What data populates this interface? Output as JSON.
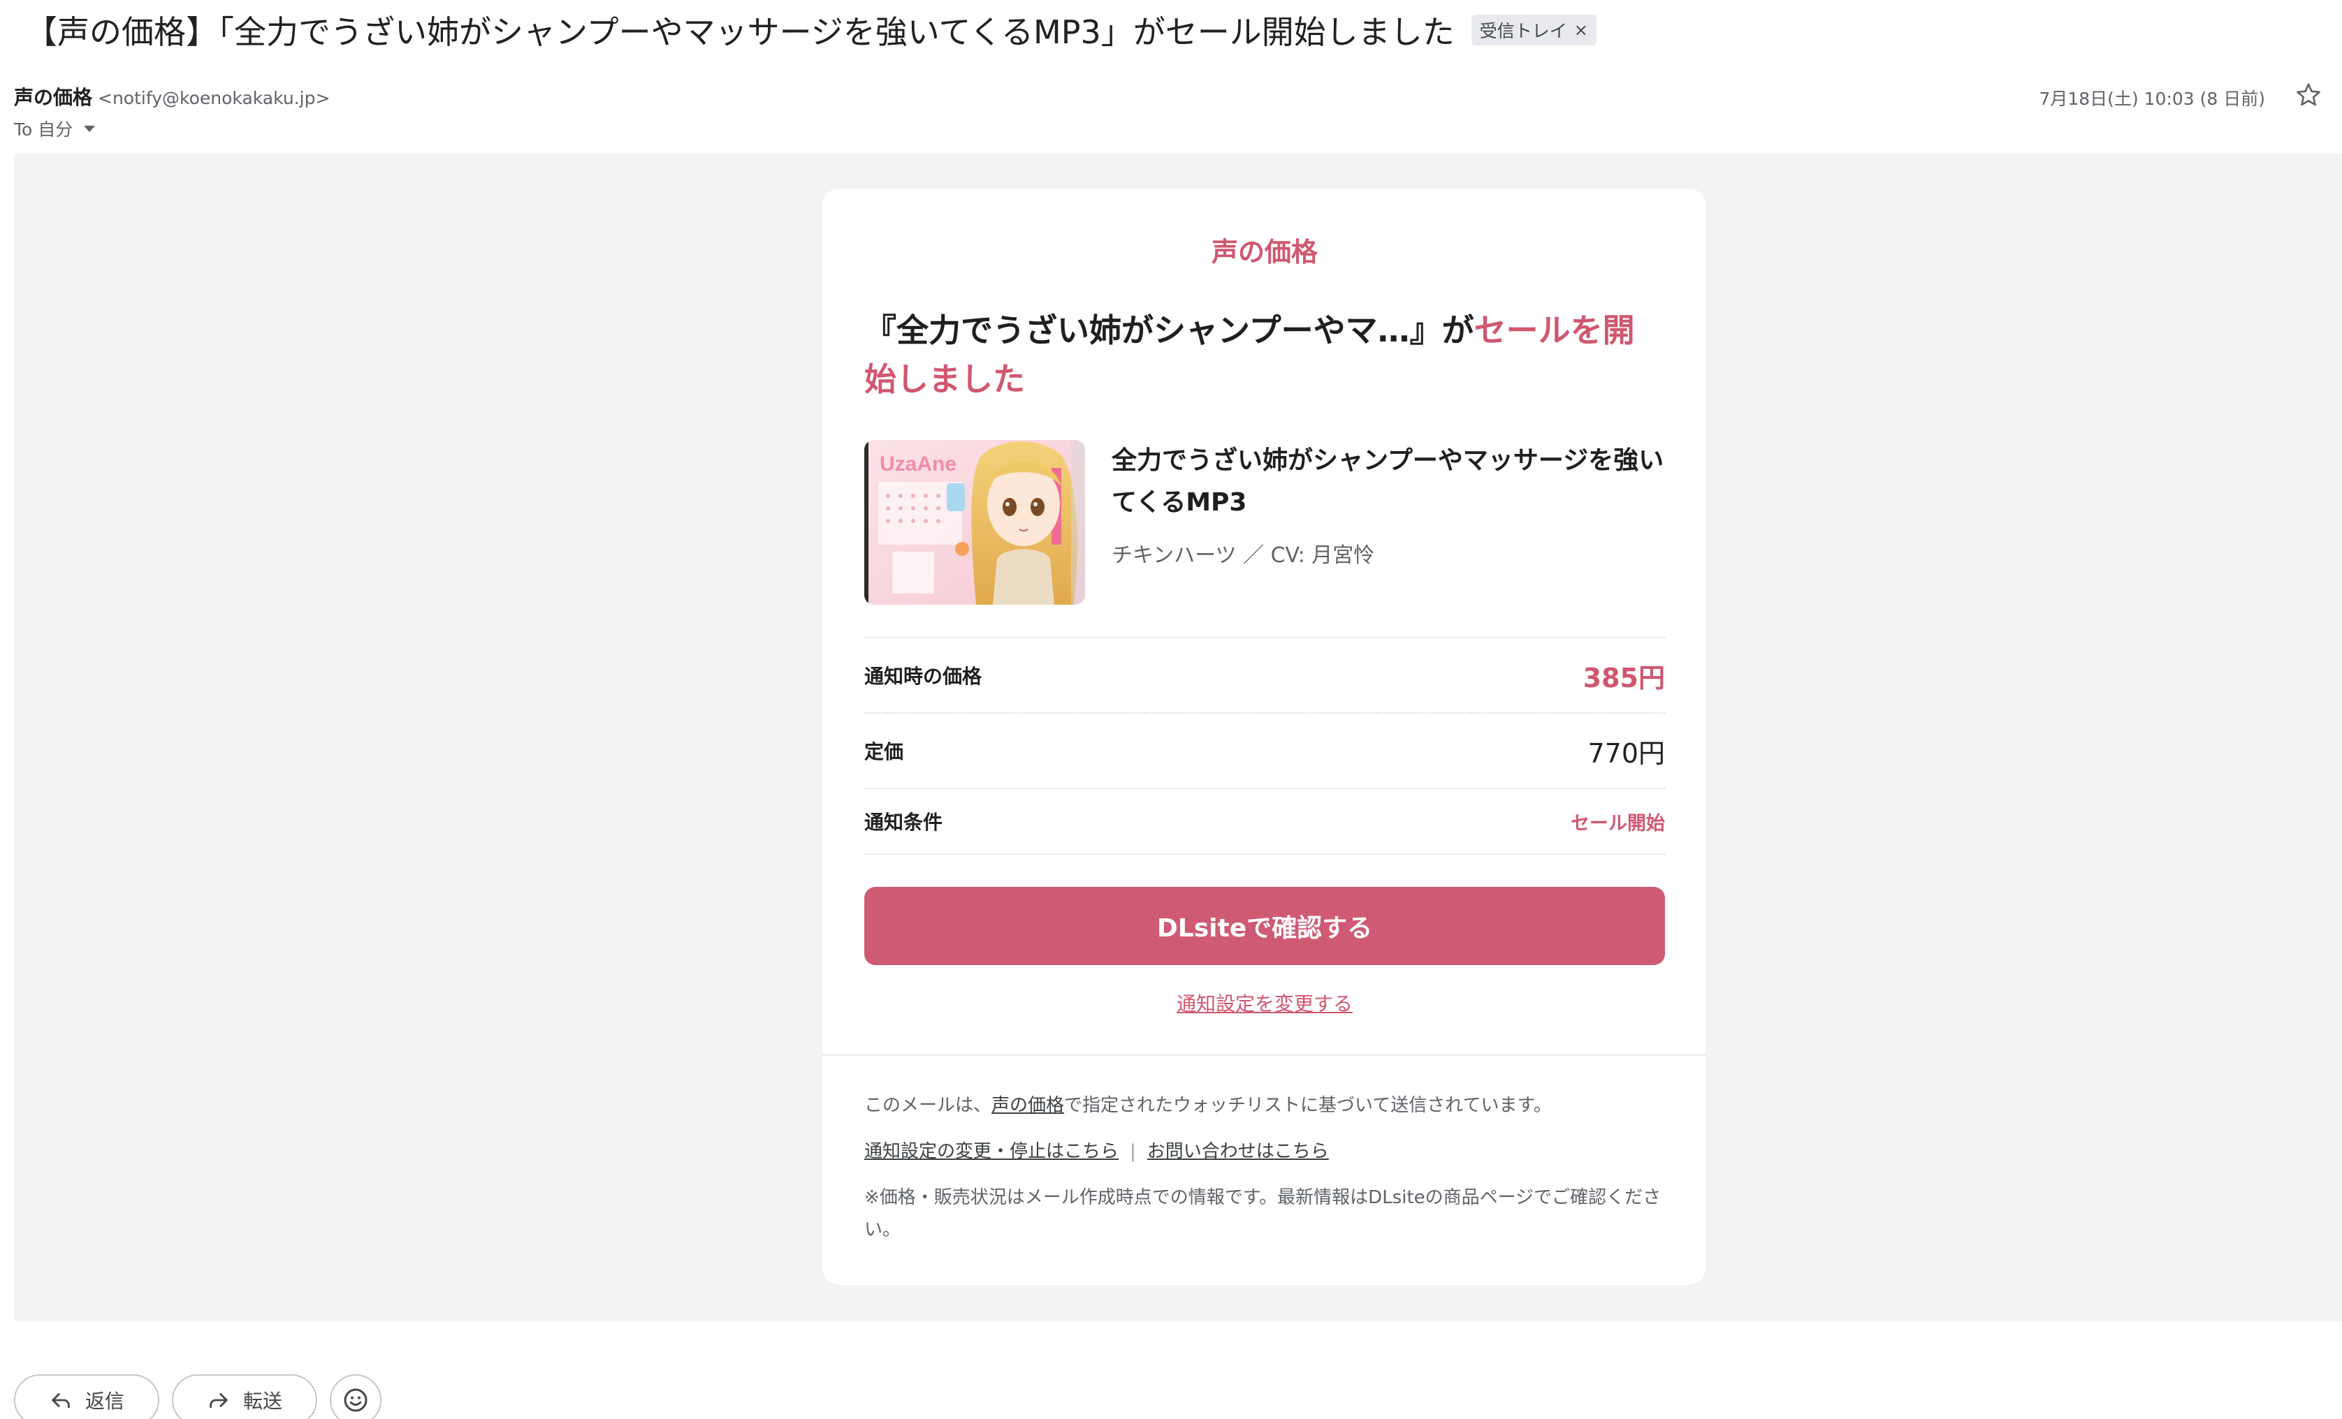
{
  "subject": {
    "text": "【声の価格】「全力でうざい姉がシャンプーやマッサージを強いてくるMP3」がセール開始しました",
    "label": "受信トレイ",
    "label_close": "×"
  },
  "sender": {
    "name": "声の価格",
    "email": "<notify@koenokakaku.jp>",
    "date": "7月18日(土) 10:03 (8 日前)",
    "to": "To 自分"
  },
  "card": {
    "brand": "声の価格",
    "headline_prefix": "『全力でうざい姉がシャンプーやマ…』が",
    "headline_accent": "セールを開始しました",
    "product_title": "全力でうざい姉がシャンプーやマッサージを強いてくるMP3",
    "product_meta": "チキンハーツ ／ CV: 月宮怜",
    "thumb_logo": "UzaAne",
    "rows": [
      {
        "label": "通知時の価格",
        "value": "385円"
      },
      {
        "label": "定価",
        "value": "770円"
      },
      {
        "label": "通知条件",
        "value": "セール開始"
      }
    ],
    "cta": "DLsiteで確認する",
    "settings_link": "通知設定を変更する"
  },
  "footer": {
    "line1_pre": "このメールは、",
    "line1_link": "声の価格",
    "line1_post": "で指定されたウォッチリストに基づいて送信されています。",
    "link_settings": "通知設定の変更・停止はこちら",
    "separator": "|",
    "link_contact": "お問い合わせはこちら",
    "note": "※価格・販売状況はメール作成時点での情報です。最新情報はDLsiteの商品ページでご確認ください。"
  },
  "actions": {
    "reply": "返信",
    "forward": "転送"
  },
  "colors": {
    "accent": "#d0576f",
    "cta_bg": "#cf5a73",
    "body_bg": "#f3f3f3"
  }
}
